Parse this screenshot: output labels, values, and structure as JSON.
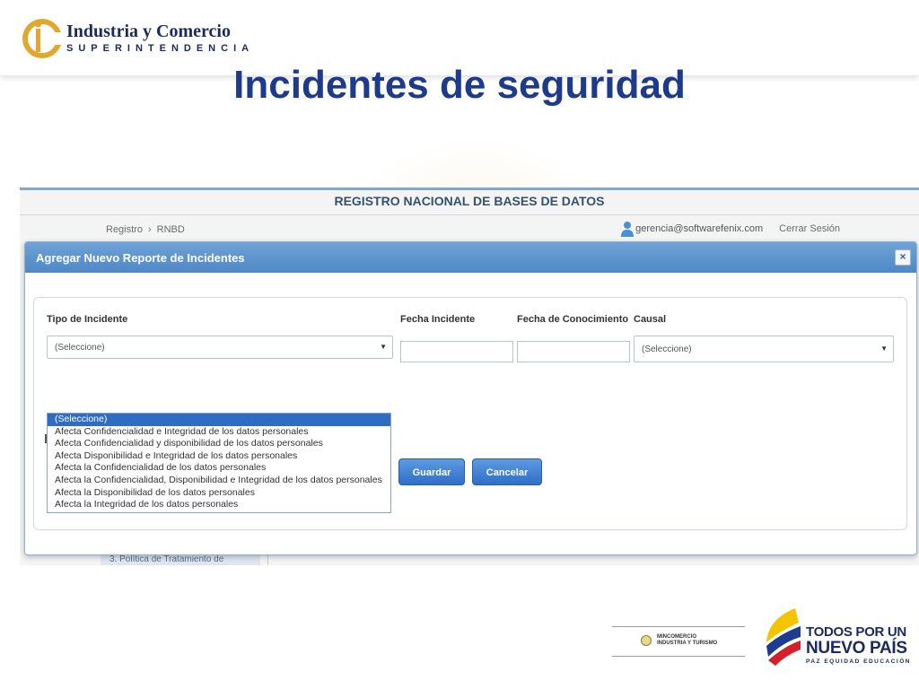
{
  "slide": {
    "logo_name": "Industria y Comercio",
    "logo_sub": "SUPERINTENDENCIA",
    "title": "Incidentes de seguridad"
  },
  "app": {
    "header_title": "REGISTRO NACIONAL DE BASES DE DATOS",
    "breadcrumb": [
      "Registro",
      "RNBD"
    ],
    "user_email": "gerencia@softwarefenix.com",
    "logout_label": "Cerrar Sesión",
    "bottom_tab_label": "3. Política de Tratamiento de"
  },
  "modal": {
    "title": "Agregar Nuevo Reporte de Incidentes",
    "close_glyph": "×",
    "fields": {
      "tipo_label": "Tipo de Incidente",
      "tipo_value": "(Seleccione)",
      "fecha_incidente_label": "Fecha Incidente",
      "fecha_incidente_value": "",
      "fecha_conocimiento_label": "Fecha de Conocimiento",
      "fecha_conocimiento_value": "",
      "causal_label": "Causal",
      "causal_value": "(Seleccione)"
    },
    "dropdown_options": [
      "(Seleccione)",
      "Afecta Confidencialidad e Integridad de los datos personales",
      "Afecta Confidencialidad y disponibilidad de los datos personales",
      "Afecta Disponibilidad e Integridad de los datos personales",
      "Afecta la Confidencialidad de los datos personales",
      "Afecta la Confidencialidad, Disponibilidad e Integridad de los datos personales",
      "Afecta la Disponibilidad de los datos personales",
      "Afecta la Integridad de los datos personales"
    ],
    "dropdown_highlighted_index": 0,
    "buttons": {
      "save": "Guardar",
      "cancel": "Cancelar"
    }
  },
  "footer": {
    "ministry_line1": "MINCOMERCIO",
    "ministry_line2": "INDUSTRIA Y TURISMO",
    "campaign_line1": "TODOS POR UN",
    "campaign_line2": "NUEVO PAÍS",
    "campaign_line3": "PAZ  EQUIDAD  EDUCACIÓN"
  },
  "colors": {
    "title_blue": "#1e3a8a",
    "header_blue": "#4f88c6",
    "button_blue": "#2e6fc8",
    "highlight_blue": "#2f6cc3"
  }
}
